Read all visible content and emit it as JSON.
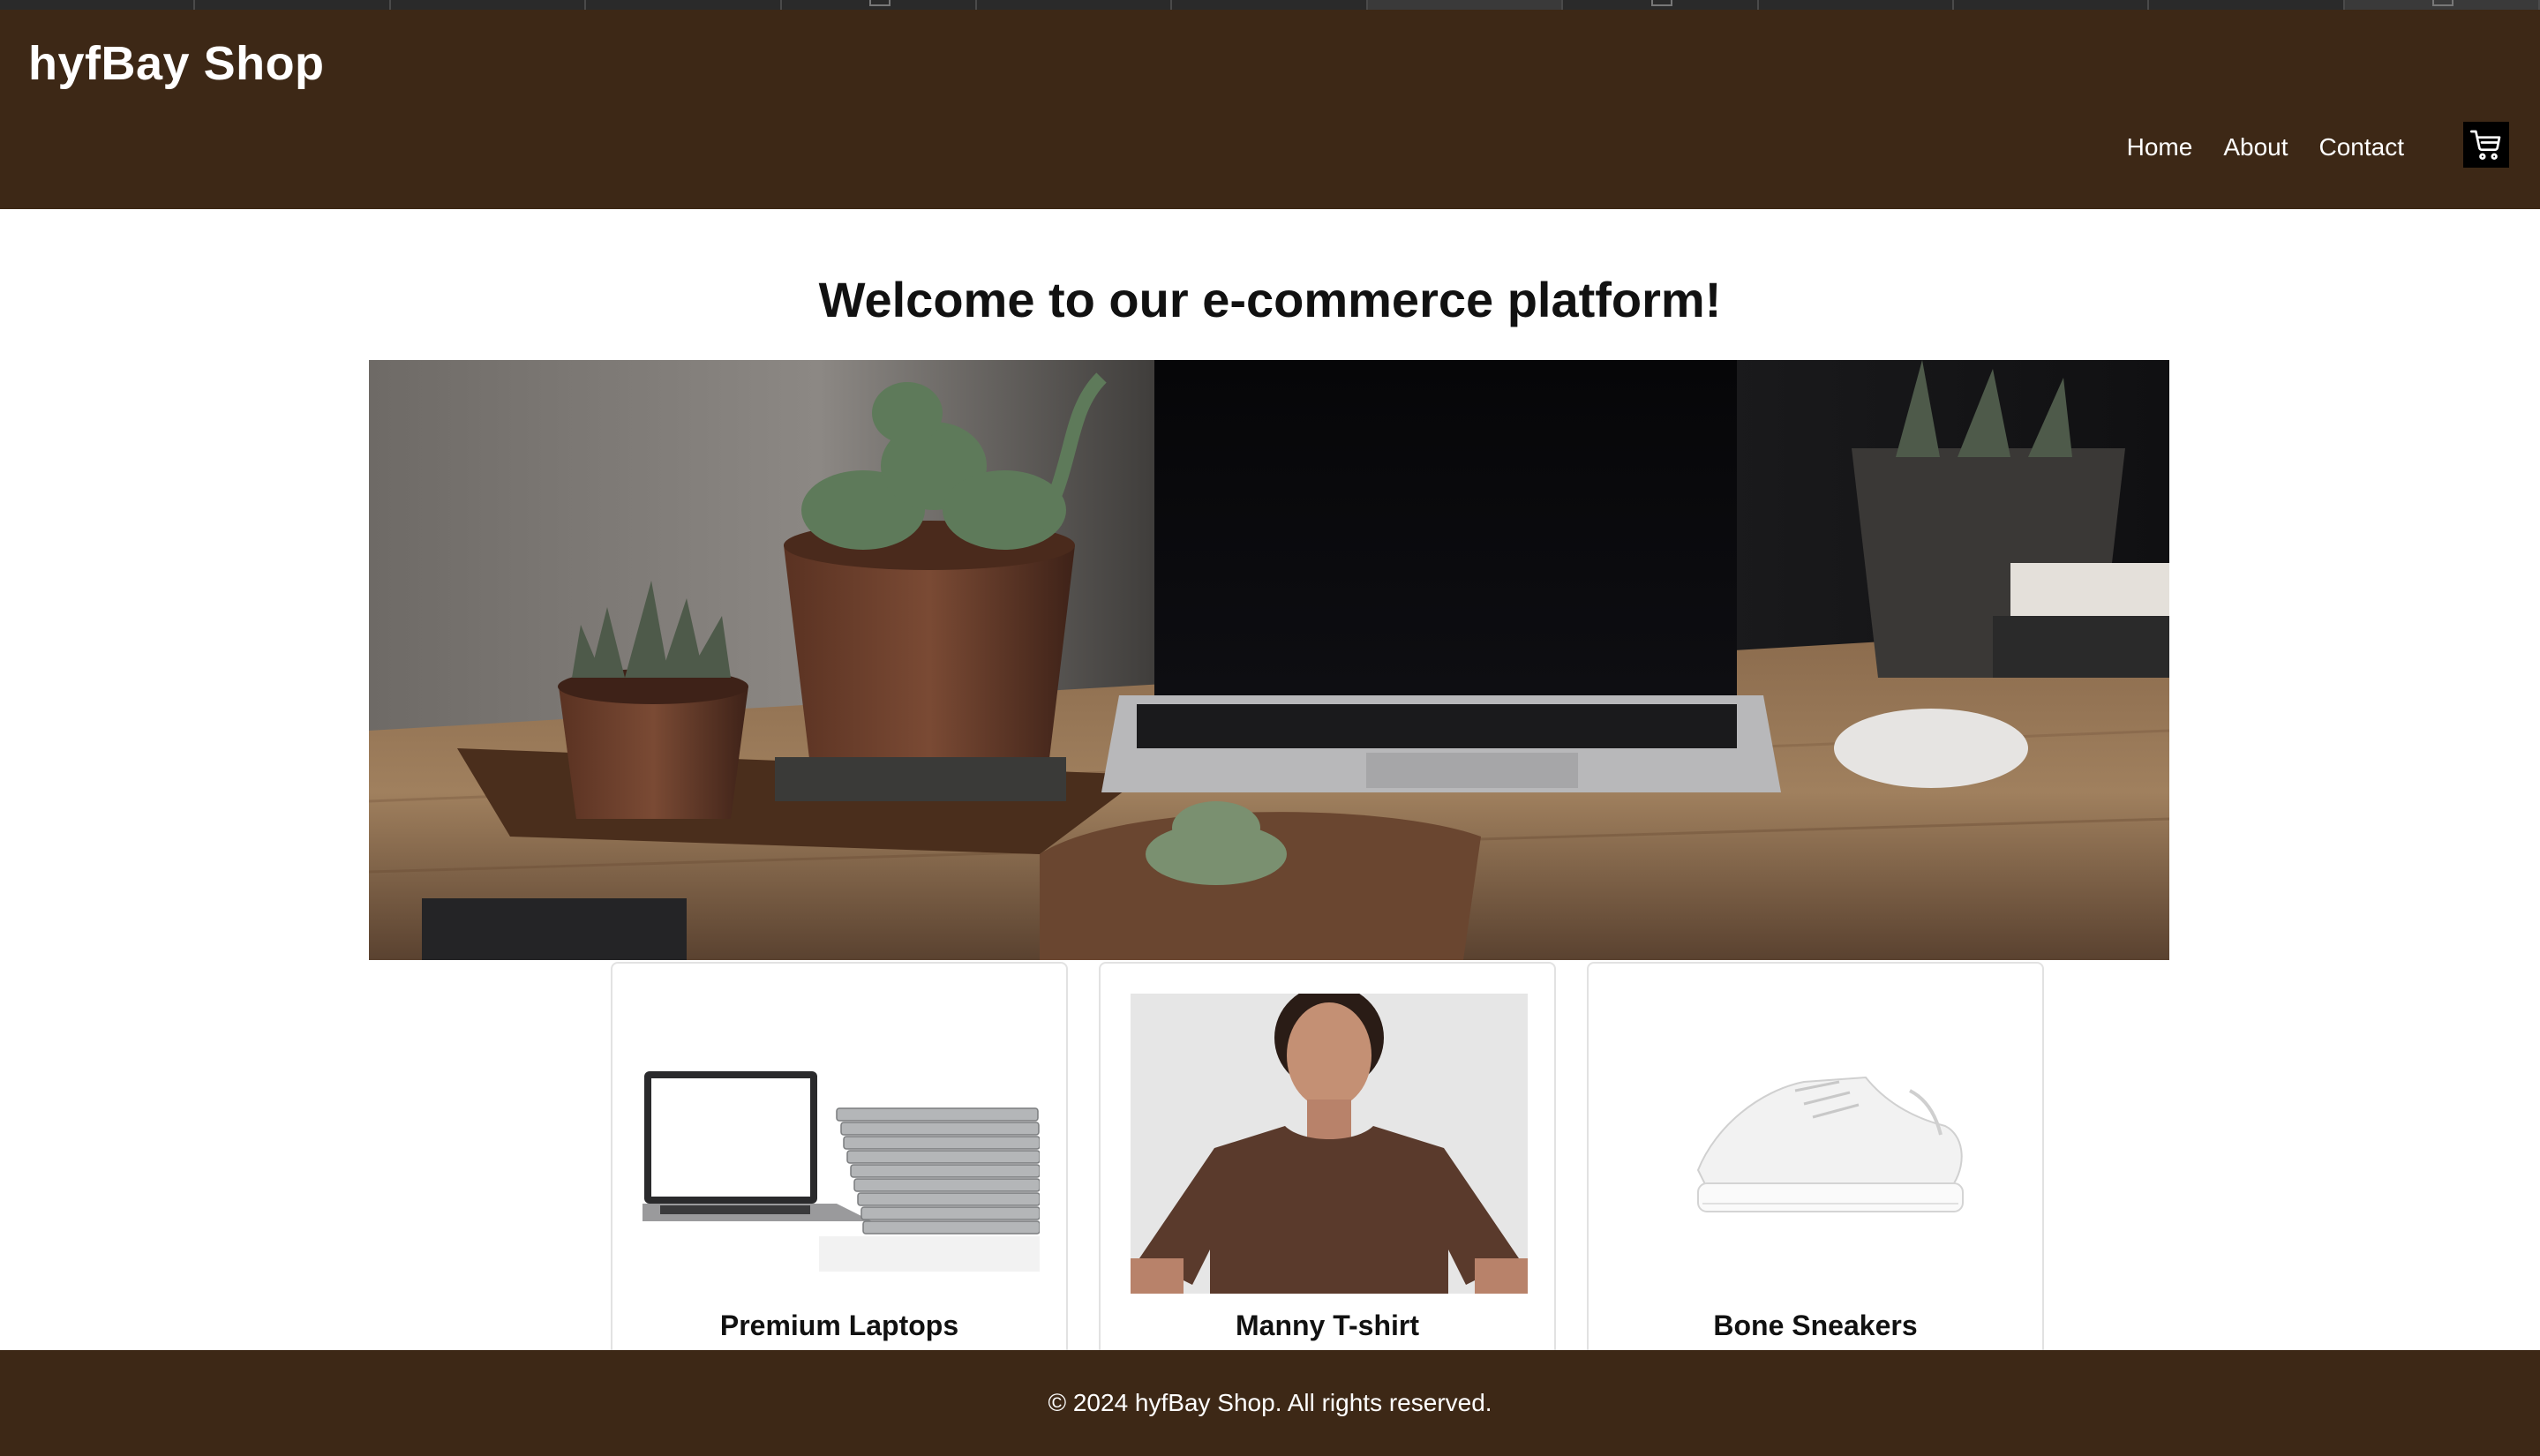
{
  "header": {
    "brand": "hyfBay Shop",
    "nav": [
      {
        "label": "Home"
      },
      {
        "label": "About"
      },
      {
        "label": "Contact"
      }
    ],
    "cart_icon": "shopping-cart-icon"
  },
  "main": {
    "welcome": "Welcome to our e-commerce platform!",
    "hero_image": "desk-with-laptop-and-succulents",
    "products": [
      {
        "name": "Premium Laptops",
        "image": "laptops-stack"
      },
      {
        "name": "Manny T-shirt",
        "image": "woman-in-brown-tshirt"
      },
      {
        "name": "Bone Sneakers",
        "image": "white-sneaker"
      }
    ]
  },
  "footer": {
    "copyright": "© 2024 hyfBay Shop. All rights reserved."
  },
  "colors": {
    "header_bg": "#3d2816",
    "footer_bg": "#3d2816",
    "page_bg": "#ffffff",
    "text_dark": "#111111",
    "card_border": "#e2e2e2"
  }
}
